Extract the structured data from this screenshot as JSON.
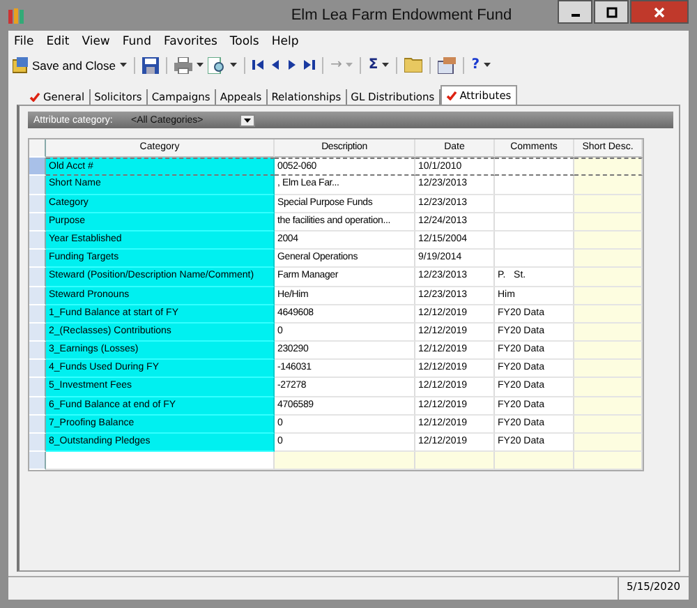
{
  "window": {
    "title": "Elm Lea Farm Endowment Fund"
  },
  "menu": [
    "File",
    "Edit",
    "View",
    "Fund",
    "Favorites",
    "Tools",
    "Help"
  ],
  "toolbar": {
    "save_close": "Save and Close",
    "arrow_symbol": "→",
    "sum_symbol": "Σ",
    "help_symbol": "?"
  },
  "tabs": [
    {
      "label": "General",
      "checked": true,
      "selected": false
    },
    {
      "label": "Solicitors",
      "checked": false,
      "selected": false
    },
    {
      "label": "Campaigns",
      "checked": false,
      "selected": false
    },
    {
      "label": "Appeals",
      "checked": false,
      "selected": false
    },
    {
      "label": "Relationships",
      "checked": false,
      "selected": false
    },
    {
      "label": "GL Distributions",
      "checked": false,
      "selected": false
    },
    {
      "label": "Attributes",
      "checked": true,
      "selected": true
    }
  ],
  "filter": {
    "label": "Attribute category:",
    "value": "<All Categories>"
  },
  "table": {
    "columns": [
      "Category",
      "Description",
      "Date",
      "Comments",
      "Short Desc."
    ],
    "rows": [
      {
        "selected": true,
        "cells": [
          "Old Acct #",
          "0052-060",
          "10/1/2010",
          ""
        ]
      },
      {
        "selected": false,
        "cells": [
          "Short Name",
          ", Elm Lea Far...",
          "12/23/2013",
          ""
        ]
      },
      {
        "selected": false,
        "cells": [
          "Category",
          "Special Purpose Funds",
          "12/23/2013",
          ""
        ]
      },
      {
        "selected": false,
        "cells": [
          "Purpose",
          "the facilities and operation...",
          "12/24/2013",
          ""
        ]
      },
      {
        "selected": false,
        "cells": [
          "Year Established",
          "2004",
          "12/15/2004",
          ""
        ]
      },
      {
        "selected": false,
        "cells": [
          "Funding Targets",
          "General Operations",
          "9/19/2014",
          ""
        ]
      },
      {
        "selected": false,
        "cells": [
          "Steward (Position/Description Name/Comment)",
          "Farm Manager",
          "12/23/2013",
          "P.   St."
        ]
      },
      {
        "selected": false,
        "cells": [
          "Steward Pronouns",
          "He/Him",
          "12/23/2013",
          "Him"
        ]
      },
      {
        "selected": false,
        "cells": [
          "1_Fund Balance at start of FY",
          "4649608",
          "12/12/2019",
          "FY20 Data"
        ]
      },
      {
        "selected": false,
        "cells": [
          "2_(Reclasses) Contributions",
          "0",
          "12/12/2019",
          "FY20 Data"
        ]
      },
      {
        "selected": false,
        "cells": [
          "3_Earnings (Losses)",
          "230290",
          "12/12/2019",
          "FY20 Data"
        ]
      },
      {
        "selected": false,
        "cells": [
          "4_Funds Used During FY",
          "-146031",
          "12/12/2019",
          "FY20 Data"
        ]
      },
      {
        "selected": false,
        "cells": [
          "5_Investment Fees",
          "-27278",
          "12/12/2019",
          "FY20 Data"
        ]
      },
      {
        "selected": false,
        "cells": [
          "6_Fund Balance at end of FY",
          "4706589",
          "12/12/2019",
          "FY20 Data"
        ]
      },
      {
        "selected": false,
        "cells": [
          "7_Proofing Balance",
          "0",
          "12/12/2019",
          "FY20 Data"
        ]
      },
      {
        "selected": false,
        "cells": [
          "8_Outstanding Pledges",
          "0",
          "12/12/2019",
          "FY20 Data"
        ]
      }
    ]
  },
  "status_bar": {
    "date": "5/15/2020"
  }
}
